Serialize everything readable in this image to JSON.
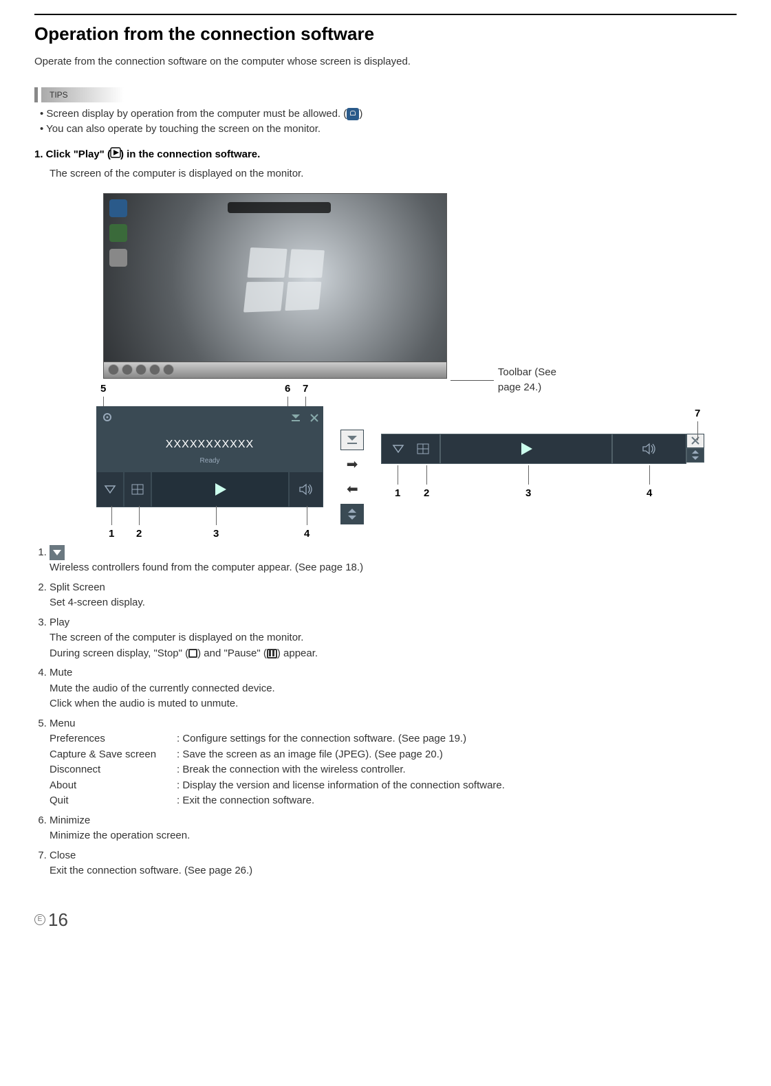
{
  "heading": "Operation from the connection software",
  "intro": "Operate from the connection software on the computer whose screen is displayed.",
  "tips_label": "TIPS",
  "tips": [
    "Screen display by operation from the computer must be allowed. (",
    "You can also operate by touching the screen on the monitor."
  ],
  "tip1_trail": ")",
  "step1_prefix": "1. Click \"Play\" (",
  "step1_suffix": ") in the connection software.",
  "step1_body": "The screen of the computer is displayed on the monitor.",
  "toolbar_note": "Toolbar (See page 24.)",
  "panel": {
    "title": "XXXXXXXXXXX",
    "status": "Ready"
  },
  "diagram_nums": {
    "n1": "1",
    "n2": "2",
    "n3": "3",
    "n4": "4",
    "n5": "5",
    "n6": "6",
    "n7": "7"
  },
  "legend": {
    "i1_body": "Wireless controllers found from the computer appear. (See page 18.)",
    "i2_title": "Split Screen",
    "i2_body": "Set 4-screen display.",
    "i3_title": "Play",
    "i3_body_a": "The screen of the computer is displayed on the monitor.",
    "i3_body_b_pre": "During screen display, \"Stop\" (",
    "i3_body_b_mid": ") and \"Pause\" (",
    "i3_body_b_post": ") appear.",
    "i4_title": "Mute",
    "i4_body_a": "Mute the audio of the currently connected device.",
    "i4_body_b": "Click when the audio is muted to unmute.",
    "i5_title": "Menu",
    "m_pref_l": "Preferences",
    "m_pref_d": ": Configure settings for the connection software. (See page 19.)",
    "m_cap_l": "Capture & Save screen",
    "m_cap_d": ": Save the screen as an image file (JPEG). (See page 20.)",
    "m_disc_l": "Disconnect",
    "m_disc_d": ": Break the connection with the wireless controller.",
    "m_about_l": "About",
    "m_about_d": ": Display the version and license information of the connection software.",
    "m_quit_l": "Quit",
    "m_quit_d": ": Exit the connection software.",
    "i6_title": "Minimize",
    "i6_body": "Minimize the operation screen.",
    "i7_title": "Close",
    "i7_body": "Exit the connection software. (See page 26.)"
  },
  "footer": {
    "e": "E",
    "page": "16"
  }
}
